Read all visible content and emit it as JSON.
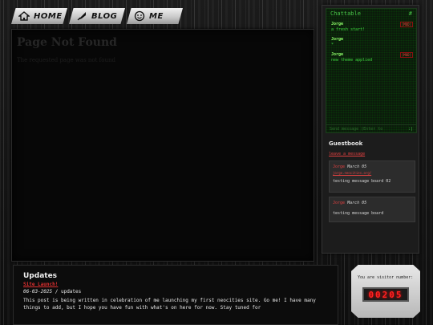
{
  "nav": {
    "items": [
      {
        "label": "HOME",
        "icon": "house-icon"
      },
      {
        "label": "BLOG",
        "icon": "quill-icon"
      },
      {
        "label": "ME",
        "icon": "face-icon"
      }
    ]
  },
  "main": {
    "title": "Page Not Found",
    "subtitle": "The requested page was not found"
  },
  "chat": {
    "title": "Chattable",
    "hash": "#",
    "messages": [
      {
        "user": "Jorge",
        "text": "a fresh start!",
        "badge": "[MOD]"
      },
      {
        "user": "Jorge",
        "text": "*",
        "badge": ""
      },
      {
        "user": "Jorge",
        "text": "new theme applied",
        "badge": "[MOD]"
      }
    ],
    "input_placeholder": "Send message (Enter to",
    "send_label": ":|"
  },
  "guestbook": {
    "title": "Guestbook",
    "leave_link": "leave a message",
    "entries": [
      {
        "name": "Jorge",
        "date": "March 05",
        "link": "jorge.neocities.org/",
        "text": "testing message board 02"
      },
      {
        "name": "Jorge",
        "date": "March 05",
        "link": "",
        "text": "testing message board"
      }
    ]
  },
  "updates": {
    "title": "Updates",
    "subtitle": "Site Launch!",
    "date": "06-03-2025",
    "separator": " / ",
    "category": "updates",
    "body": "This post is being written in celebration of me launching my first neocities site. Go me! I have many things to add, but I hope you have fun with what's on here for now. Stay tuned for"
  },
  "counter": {
    "label": "You are visitor number:",
    "digits": "00205"
  }
}
